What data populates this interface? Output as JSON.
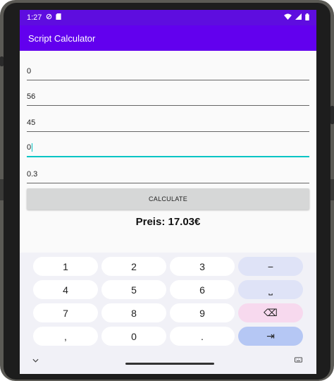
{
  "status_bar": {
    "time": "1:27"
  },
  "app_bar": {
    "title": "Script Calculator"
  },
  "fields": [
    {
      "value": "0"
    },
    {
      "value": "56"
    },
    {
      "value": "45"
    },
    {
      "value": "0"
    },
    {
      "value": "0.3"
    }
  ],
  "calculate_button": {
    "label": "CALCULATE"
  },
  "result": {
    "text": "Preis: 17.03€"
  },
  "keyboard": {
    "keys": {
      "k1": "1",
      "k2": "2",
      "k3": "3",
      "minus": "−",
      "k4": "4",
      "k5": "5",
      "k6": "6",
      "space": "⎵",
      "k7": "7",
      "k8": "8",
      "k9": "9",
      "backspace": "⌫",
      "comma": ",",
      "k0": "0",
      "period": ".",
      "tab": "⇥"
    }
  },
  "colors": {
    "status_bar": "#5e0ddf",
    "app_bar": "#6200ee",
    "focus_accent": "#03c4c4"
  }
}
